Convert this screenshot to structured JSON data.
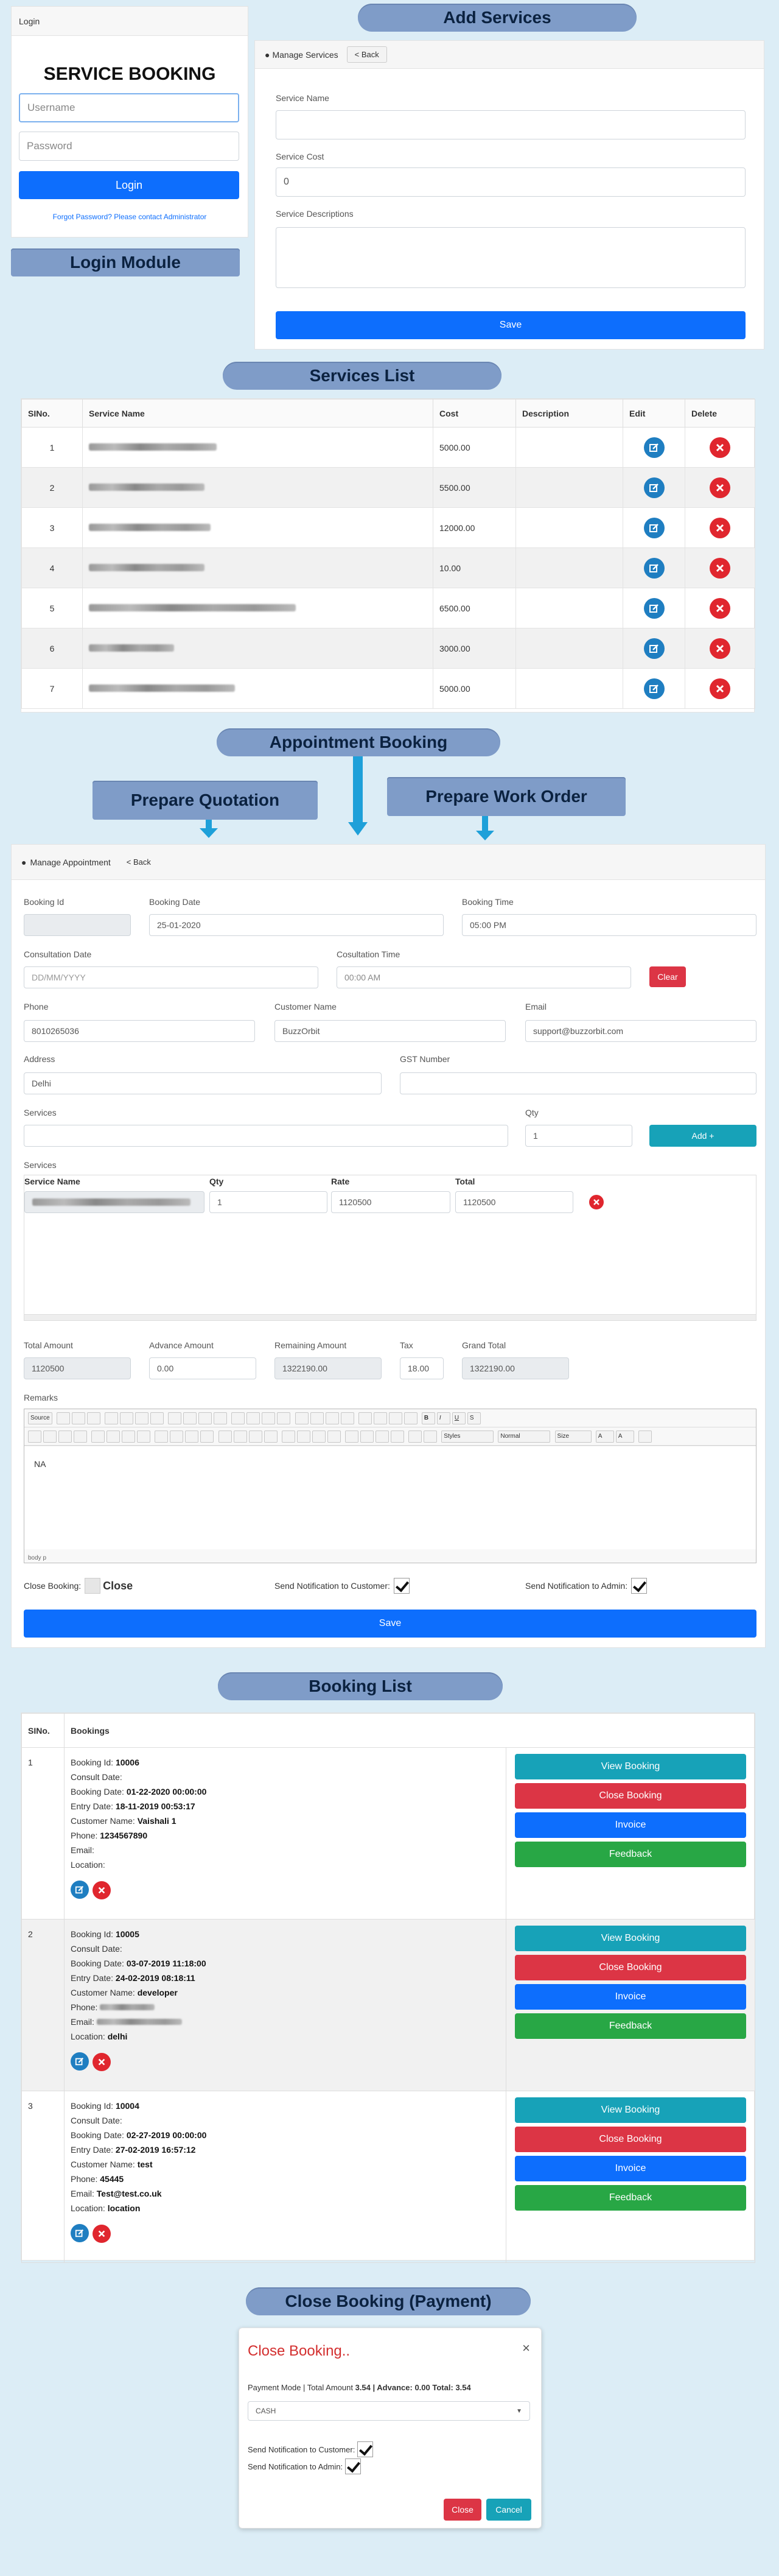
{
  "ribbons": {
    "add_services": "Add Services",
    "login_module": "Login Module",
    "services_list": "Services List",
    "appointment_booking": "Appointment Booking",
    "prepare_quotation": "Prepare Quotation",
    "prepare_work_order": "Prepare Work Order",
    "booking_list": "Booking List",
    "close_booking": "Close Booking (Payment)"
  },
  "login": {
    "tab": "Login",
    "title": "SERVICE BOOKING",
    "username_placeholder": "Username",
    "password_placeholder": "Password",
    "login_button": "Login",
    "forgot": "Forgot Password? Please contact Administrator"
  },
  "add_service": {
    "header": "Manage Services",
    "back": "< Back",
    "name_label": "Service Name",
    "cost_label": "Service Cost",
    "cost_value": "0",
    "desc_label": "Service Descriptions",
    "save": "Save"
  },
  "services": {
    "headers": [
      "SINo.",
      "Service Name",
      "Cost",
      "Description",
      "Edit",
      "Delete"
    ],
    "rows": [
      {
        "no": "1",
        "cost": "5000.00"
      },
      {
        "no": "2",
        "cost": "5500.00"
      },
      {
        "no": "3",
        "cost": "12000.00"
      },
      {
        "no": "4",
        "cost": "10.00"
      },
      {
        "no": "5",
        "cost": "6500.00"
      },
      {
        "no": "6",
        "cost": "3000.00"
      },
      {
        "no": "7",
        "cost": "5000.00"
      }
    ]
  },
  "appointment": {
    "header": "Manage Appointment",
    "back": "< Back",
    "booking_id_label": "Booking Id",
    "booking_date_label": "Booking Date",
    "booking_date": "25-01-2020",
    "booking_time_label": "Booking Time",
    "booking_time": "05:00 PM",
    "consult_date_label": "Consultation Date",
    "consult_date_placeholder": "DD/MM/YYYY",
    "consult_time_label": "Cosultation Time",
    "consult_time": "00:00 AM",
    "clear": "Clear",
    "phone_label": "Phone",
    "phone": "8010265036",
    "customer_label": "Customer Name",
    "customer": "BuzzOrbit",
    "email_label": "Email",
    "email": "support@buzzorbit.com",
    "address_label": "Address",
    "address": "Delhi",
    "gst_label": "GST Number",
    "services_label": "Services",
    "qty_label": "Qty",
    "qty": "1",
    "add_button": "Add +",
    "services_section": "Services",
    "grid_headers": [
      "Service Name",
      "Qty",
      "Rate",
      "Total"
    ],
    "grid_row": {
      "qty": "1",
      "rate": "1120500",
      "total": "1120500"
    },
    "total_label": "Total Amount",
    "total": "1120500",
    "advance_label": "Advance Amount",
    "advance": "0.00",
    "remaining_label": "Remaining Amount",
    "remaining": "1322190.00",
    "tax_label": "Tax",
    "tax": "18.00",
    "grand_label": "Grand Total",
    "grand": "1322190.00",
    "remarks_label": "Remarks",
    "editor_source": "Source",
    "editor_styles": "Styles",
    "editor_normal": "Normal",
    "editor_size": "Size",
    "remarks_text": "NA",
    "editor_footer": "body p",
    "close_booking_label": "Close Booking:",
    "close_text": "Close",
    "notify_customer": "Send Notification to Customer:",
    "notify_admin": "Send Notification to Admin:",
    "save": "Save"
  },
  "booking_list": {
    "headers": [
      "SINo.",
      "Bookings"
    ],
    "items": [
      {
        "no": "1",
        "id": "10006",
        "consult": "",
        "booking_date": "01-22-2020 00:00:00",
        "entry_date": "18-11-2019 00:53:17",
        "customer": "Vaishali 1",
        "phone": "1234567890",
        "email": "",
        "location": ""
      },
      {
        "no": "2",
        "id": "10005",
        "consult": "",
        "booking_date": "03-07-2019 11:18:00",
        "entry_date": "24-02-2019 08:18:11",
        "customer": "developer",
        "phone": "",
        "email": "",
        "location": "delhi"
      },
      {
        "no": "3",
        "id": "10004",
        "consult": "",
        "booking_date": "02-27-2019 00:00:00",
        "entry_date": "27-02-2019 16:57:12",
        "customer": "test",
        "phone": "45445",
        "email": "Test@test.co.uk",
        "location": "location"
      }
    ],
    "labels": {
      "id": "Booking Id:",
      "consult": "Consult Date:",
      "booking_date": "Booking Date:",
      "entry_date": "Entry Date:",
      "customer": "Customer Name:",
      "phone": "Phone:",
      "email": "Email:",
      "location": "Location:"
    },
    "buttons": {
      "view": "View Booking",
      "close": "Close Booking",
      "invoice": "Invoice",
      "feedback": "Feedback"
    }
  },
  "modal": {
    "title": "Close Booking..",
    "close_x": "×",
    "mode_prefix": "Payment Mode | Total Amount",
    "total": "3.54",
    "advance_label": "| Advance:",
    "advance": "0.00",
    "total_label": "Total:",
    "total2": "3.54",
    "payment_mode": "CASH",
    "notify_customer": "Send Notification to Customer:",
    "notify_admin": "Send Notification to Admin:",
    "close": "Close",
    "cancel": "Cancel"
  }
}
